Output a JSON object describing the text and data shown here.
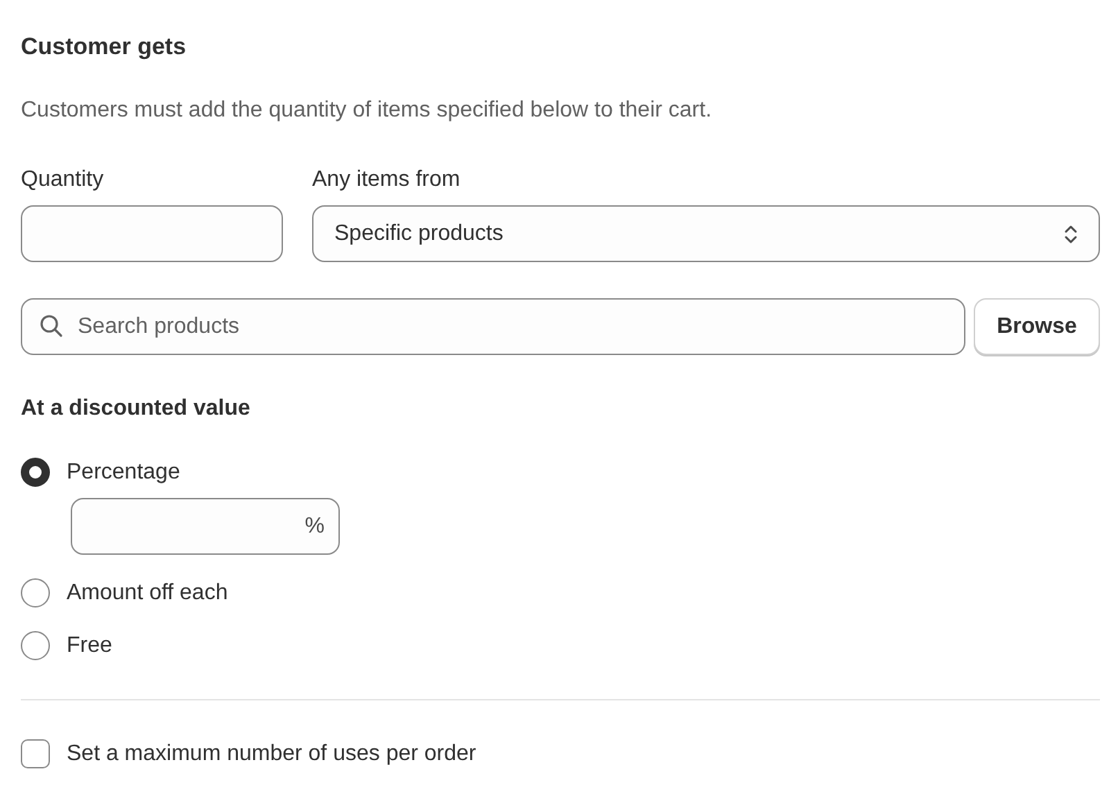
{
  "section": {
    "title": "Customer gets",
    "description": "Customers must add the quantity of items specified below to their cart."
  },
  "quantity": {
    "label": "Quantity"
  },
  "items_from": {
    "label": "Any items from",
    "value": "Specific products"
  },
  "search": {
    "placeholder": "Search products",
    "button": "Browse"
  },
  "discount": {
    "title": "At a discounted value",
    "options": [
      {
        "label": "Percentage",
        "selected": true,
        "field": {
          "suffix": "%"
        }
      },
      {
        "label": "Amount off each",
        "selected": false
      },
      {
        "label": "Free",
        "selected": false
      }
    ]
  },
  "max_uses": {
    "label": "Set a maximum number of uses per order",
    "checked": false
  }
}
